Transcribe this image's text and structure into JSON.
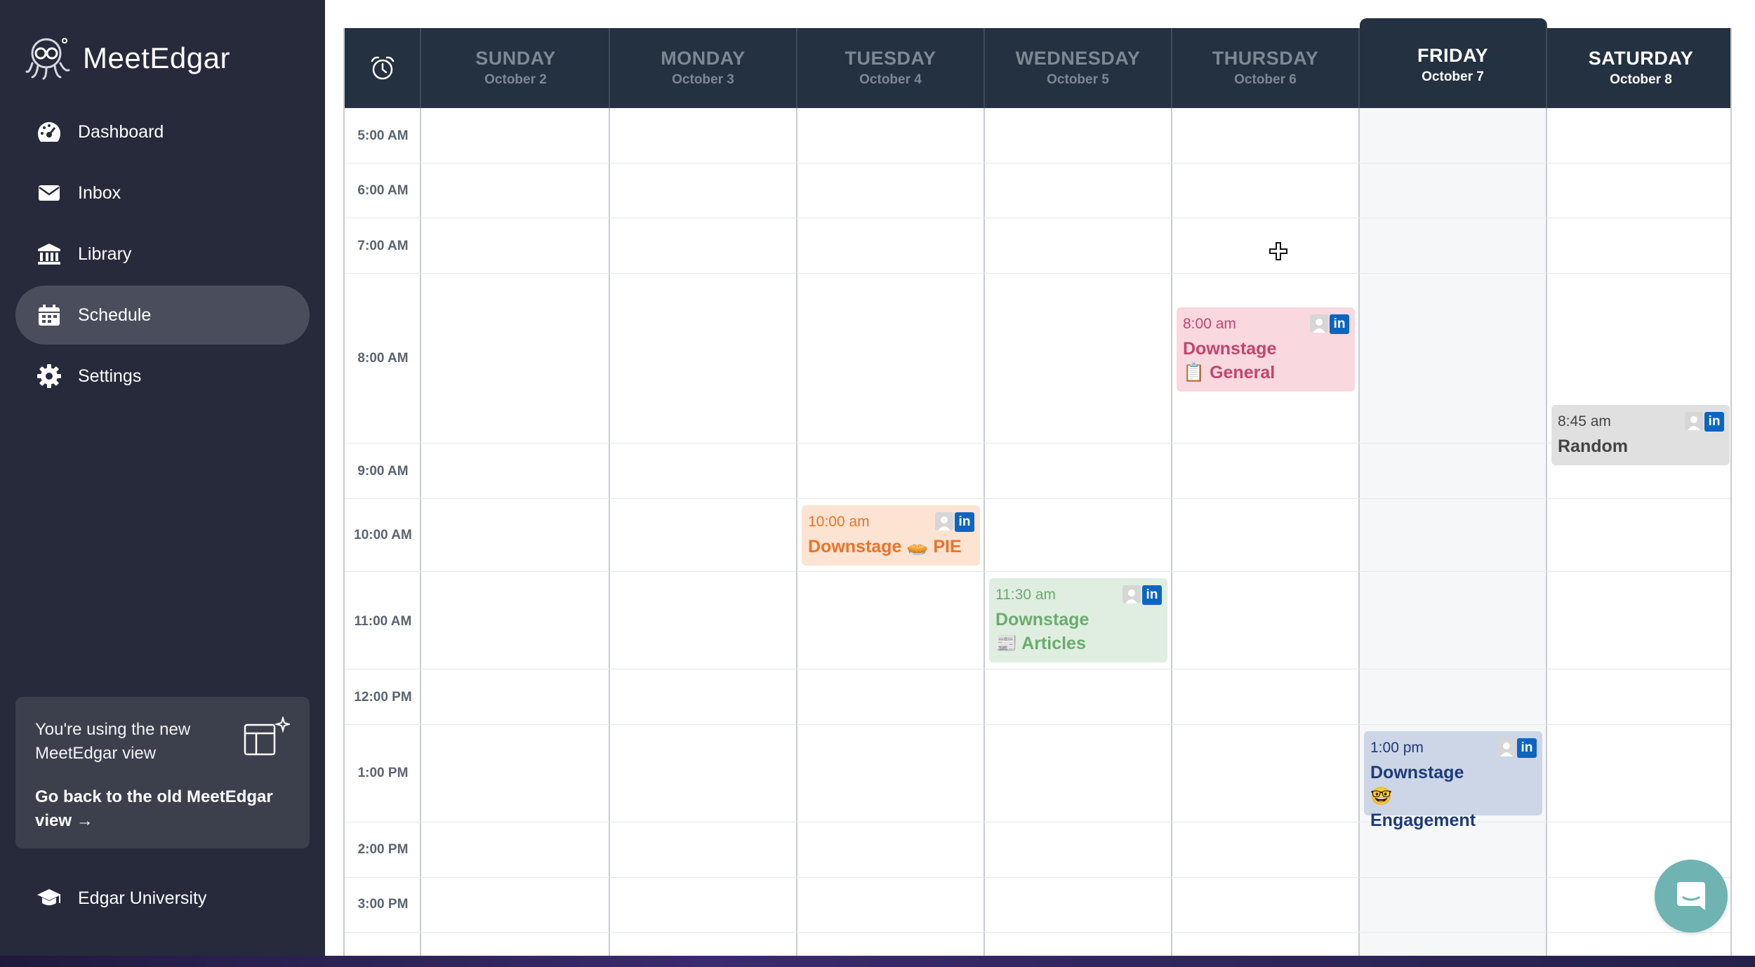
{
  "app": {
    "name": "MeetEdgar"
  },
  "sidebar": {
    "items": [
      {
        "label": "Dashboard",
        "icon": "speedometer-icon",
        "active": false
      },
      {
        "label": "Inbox",
        "icon": "envelope-icon",
        "active": false
      },
      {
        "label": "Library",
        "icon": "library-building-icon",
        "active": false
      },
      {
        "label": "Schedule",
        "icon": "calendar-icon",
        "active": true
      },
      {
        "label": "Settings",
        "icon": "gear-icon",
        "active": false
      }
    ],
    "new_view_card": {
      "text": "You're using the new MeetEdgar view",
      "link": "Go back to the old MeetEdgar view →"
    },
    "footer_item": {
      "label": "Edgar University",
      "icon": "graduation-cap-icon"
    }
  },
  "calendar": {
    "corner_icon": "alarm-clock-icon",
    "days": [
      {
        "name": "SUNDAY",
        "date": "October 2"
      },
      {
        "name": "MONDAY",
        "date": "October 3"
      },
      {
        "name": "TUESDAY",
        "date": "October 4"
      },
      {
        "name": "WEDNESDAY",
        "date": "October 5"
      },
      {
        "name": "THURSDAY",
        "date": "October 6"
      },
      {
        "name": "FRIDAY",
        "date": "October 7"
      },
      {
        "name": "SATURDAY",
        "date": "October 8"
      }
    ],
    "today": "FRIDAY",
    "times": [
      "5:00 AM",
      "6:00 AM",
      "7:00 AM",
      "8:00 AM",
      "9:00 AM",
      "10:00 AM",
      "11:00 AM",
      "12:00 PM",
      "1:00 PM",
      "2:00 PM",
      "3:00 PM"
    ],
    "events": [
      {
        "day": "THURSDAY",
        "time": "8:00 am",
        "title": "Downstage 📋 General",
        "color": "#f9d8df",
        "text_color": "#c2456b"
      },
      {
        "day": "SATURDAY",
        "time": "8:45 am",
        "title": "Random",
        "color": "#e0e0e0",
        "text_color": "#444444"
      },
      {
        "day": "TUESDAY",
        "time": "10:00 am",
        "title": "Downstage 🥧 PIE",
        "color": "#fde3d2",
        "text_color": "#e8742a"
      },
      {
        "day": "WEDNESDAY",
        "time": "11:30 am",
        "title": "Downstage 📰 Articles",
        "color": "#dfeee0",
        "text_color": "#6bab6e"
      },
      {
        "day": "FRIDAY",
        "time": "1:00 pm",
        "title": "Downstage 🤓 Engagement",
        "color": "#ccd6e6",
        "text_color": "#1e3a78"
      }
    ],
    "event_icons": [
      "person-icon",
      "linkedin-icon"
    ],
    "linkedin_glyph": "in"
  },
  "colors": {
    "sidebar_bg": "#262a3b",
    "header_bg": "#233140",
    "active_nav": "#4a4e5c",
    "chat_button": "#6fb3b3"
  }
}
